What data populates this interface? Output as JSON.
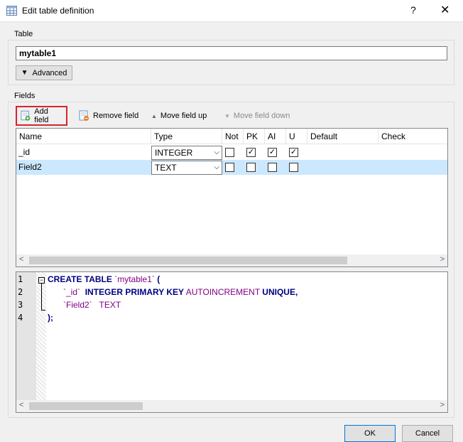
{
  "window": {
    "title": "Edit table definition",
    "help_label": "?",
    "close_label": "✕"
  },
  "table_group": {
    "label": "Table",
    "name_value": "mytable1",
    "advanced_label": "Advanced"
  },
  "fields_group": {
    "label": "Fields",
    "toolbar": {
      "add_label": "Add field",
      "remove_label": "Remove field",
      "move_up_label": "Move field up",
      "move_down_label": "Move field down"
    },
    "columns": [
      "Name",
      "Type",
      "Not",
      "PK",
      "AI",
      "U",
      "Default",
      "Check"
    ],
    "rows": [
      {
        "name": "_id",
        "type": "INTEGER",
        "not_null": false,
        "pk": true,
        "ai": true,
        "unique": true
      },
      {
        "name": "Field2",
        "type": "TEXT",
        "not_null": false,
        "pk": false,
        "ai": false,
        "unique": false
      }
    ]
  },
  "sql": {
    "line_numbers": [
      "1",
      "2",
      "3",
      "4"
    ],
    "lines": {
      "l1_kw": "CREATE TABLE ",
      "l1_ident": "`mytable1`",
      "l1_paren": " (",
      "l2_ident": "`_id`",
      "l2_type": "INTEGER PRIMARY KEY",
      "l2_ai": "AUTOINCREMENT",
      "l2_unique": "UNIQUE",
      "l2_comma": ",",
      "l3_ident": "`Field2`",
      "l3_type": "TEXT",
      "l4": ");"
    }
  },
  "buttons": {
    "ok": "OK",
    "cancel": "Cancel"
  },
  "colors": {
    "selected_row": "#cce8ff",
    "highlight_border": "#d9232b",
    "keyword": "#000080",
    "identifier": "#800080"
  }
}
